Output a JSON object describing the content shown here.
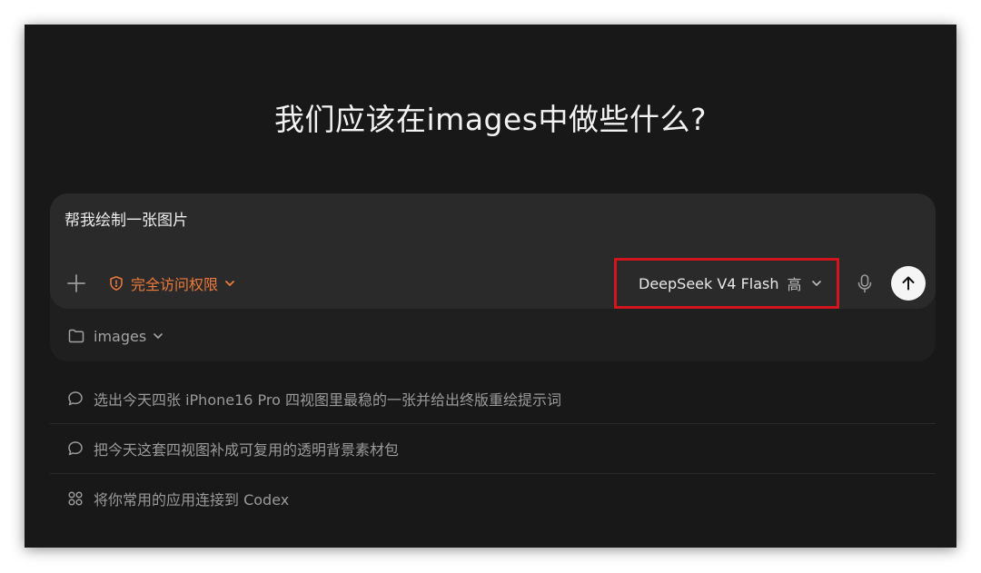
{
  "heading": "我们应该在images中做些什么?",
  "composer": {
    "input_value": "帮我绘制一张图片",
    "add_icon": "plus-icon",
    "access": {
      "icon": "shield-alert-icon",
      "label": "完全访问权限",
      "color": "#f07a3a"
    },
    "model": {
      "name": "DeepSeek V4 Flash",
      "effort": "高",
      "highlight_color": "#d0151d"
    },
    "mic_icon": "microphone-icon",
    "send_icon": "arrow-up-icon"
  },
  "workspace": {
    "icon": "folder-icon",
    "label": "images"
  },
  "suggestions": [
    {
      "icon": "chat-bubble-icon",
      "text": "选出今天四张 iPhone16 Pro 四视图里最稳的一张并给出终版重绘提示词"
    },
    {
      "icon": "chat-bubble-icon",
      "text": "把今天这套四视图补成可复用的透明背景素材包"
    },
    {
      "icon": "apps-grid-icon",
      "text": "将你常用的应用连接到 Codex"
    }
  ],
  "colors": {
    "window_bg": "#181818",
    "composer_bg": "#2a2a2a",
    "send_button_bg": "#f5f5f5"
  }
}
